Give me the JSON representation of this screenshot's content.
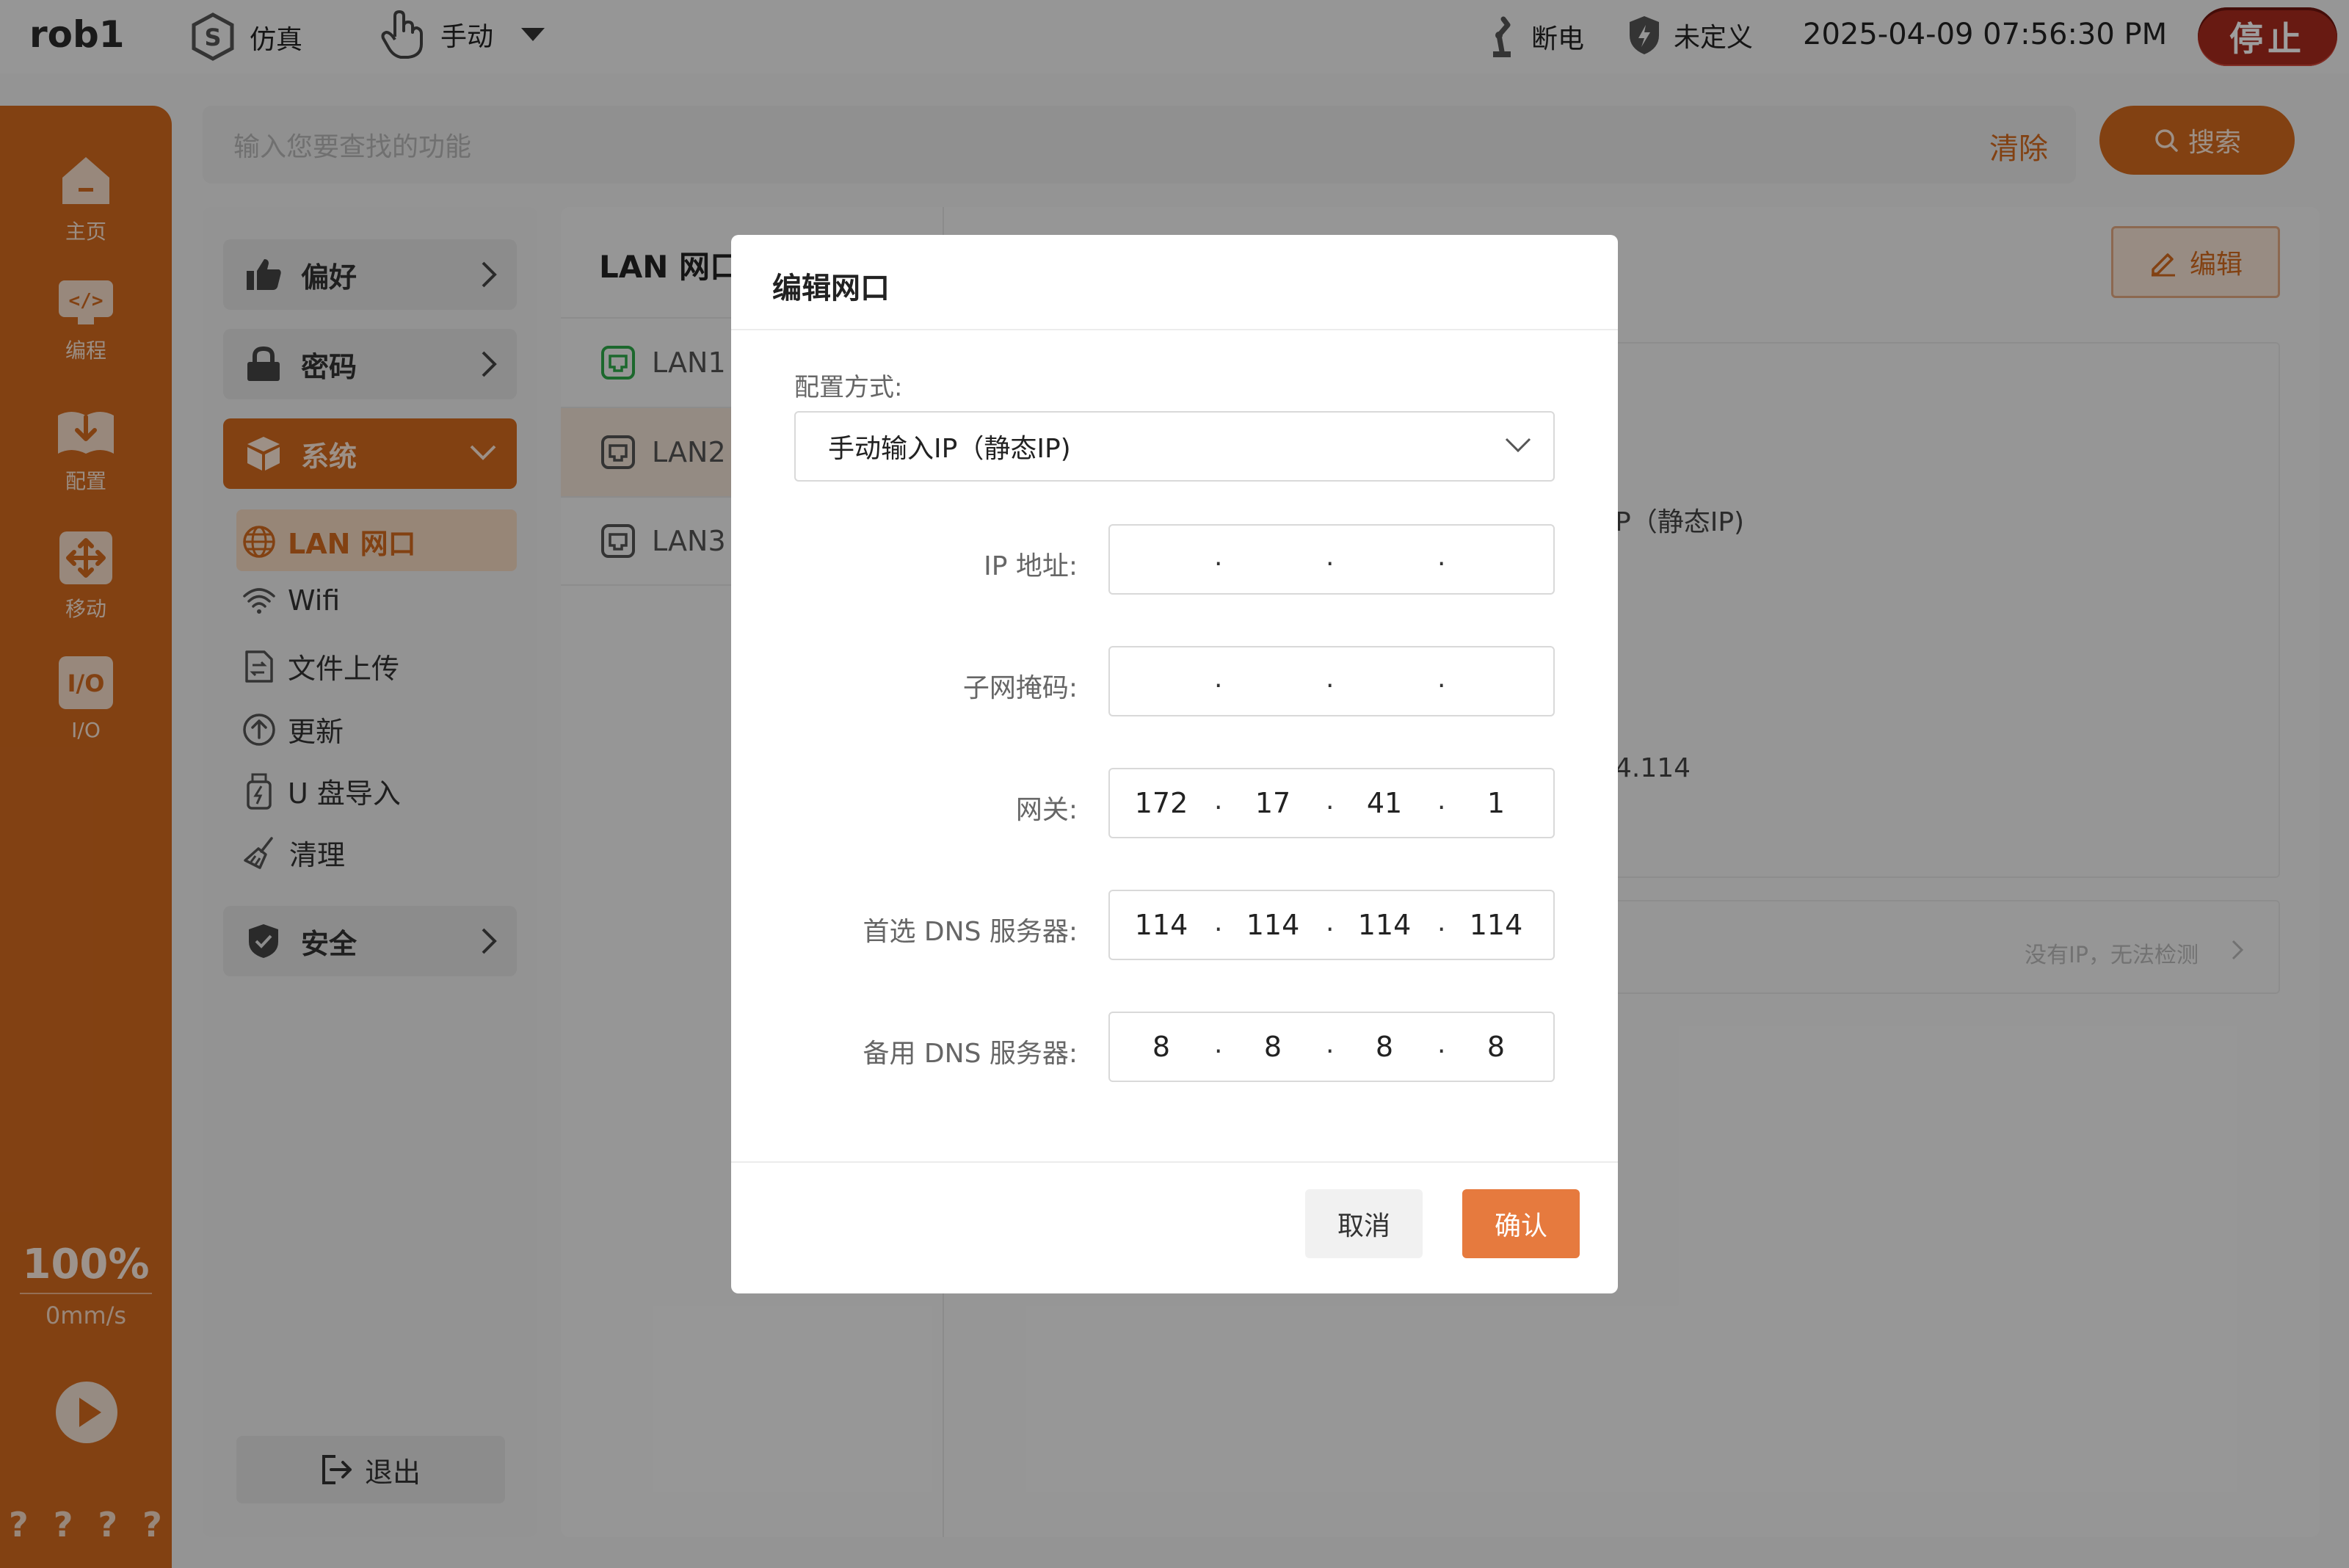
{
  "topbar": {
    "app_name": "rob1",
    "mode_sim": "仿真",
    "mode_manual": "手动",
    "power_status": "断电",
    "safety_status": "未定义",
    "datetime": "2025-04-09 07:56:30 PM",
    "stop_label": "停止"
  },
  "rail": {
    "items": [
      {
        "label": "主页",
        "icon": "home-icon"
      },
      {
        "label": "编程",
        "icon": "code-icon"
      },
      {
        "label": "配置",
        "icon": "download-book-icon"
      },
      {
        "label": "移动",
        "icon": "move-icon"
      },
      {
        "label": "I/O",
        "icon": "io-icon"
      }
    ],
    "speed_percent": "100%",
    "speed_value": "0mm/s",
    "bottom_marks": [
      "?",
      "?",
      "?",
      "?"
    ]
  },
  "search": {
    "placeholder": "输入您要查找的功能",
    "clear_label": "清除",
    "button_label": "搜索"
  },
  "nav": {
    "preference": "偏好",
    "password": "密码",
    "system": "系统",
    "system_items": [
      {
        "label": "LAN 网口",
        "icon": "globe-icon"
      },
      {
        "label": "Wifi",
        "icon": "wifi-icon"
      },
      {
        "label": "文件上传",
        "icon": "file-upload-icon"
      },
      {
        "label": "更新",
        "icon": "update-icon"
      },
      {
        "label": "U 盘导入",
        "icon": "usb-icon"
      },
      {
        "label": "清理",
        "icon": "broom-icon"
      }
    ],
    "security": "安全",
    "logout": "退出"
  },
  "lan": {
    "title": "LAN 网口",
    "ports": [
      "LAN1",
      "LAN2",
      "LAN3"
    ],
    "edit_label": "编辑",
    "bg_config_text": "P（静态IP)",
    "bg_dns_text": "4.114",
    "detect_text": "没有IP，无法检测"
  },
  "modal": {
    "title": "编辑网口",
    "config_label": "配置方式:",
    "config_value": "手动输入IP（静态IP)",
    "fields": {
      "ip": {
        "label": "IP 地址:",
        "segments": [
          "",
          "",
          "",
          ""
        ]
      },
      "mask": {
        "label": "子网掩码:",
        "segments": [
          "",
          "",
          "",
          ""
        ]
      },
      "gateway": {
        "label": "网关:",
        "segments": [
          "172",
          "17",
          "41",
          "1"
        ]
      },
      "dns1": {
        "label": "首选 DNS 服务器:",
        "segments": [
          "114",
          "114",
          "114",
          "114"
        ]
      },
      "dns2": {
        "label": "备用 DNS 服务器:",
        "segments": [
          "8",
          "8",
          "8",
          "8"
        ]
      }
    },
    "cancel_label": "取消",
    "confirm_label": "确认"
  },
  "colors": {
    "accent": "#d2691e",
    "stop": "#a82a1e",
    "confirm": "#e67a3e"
  }
}
